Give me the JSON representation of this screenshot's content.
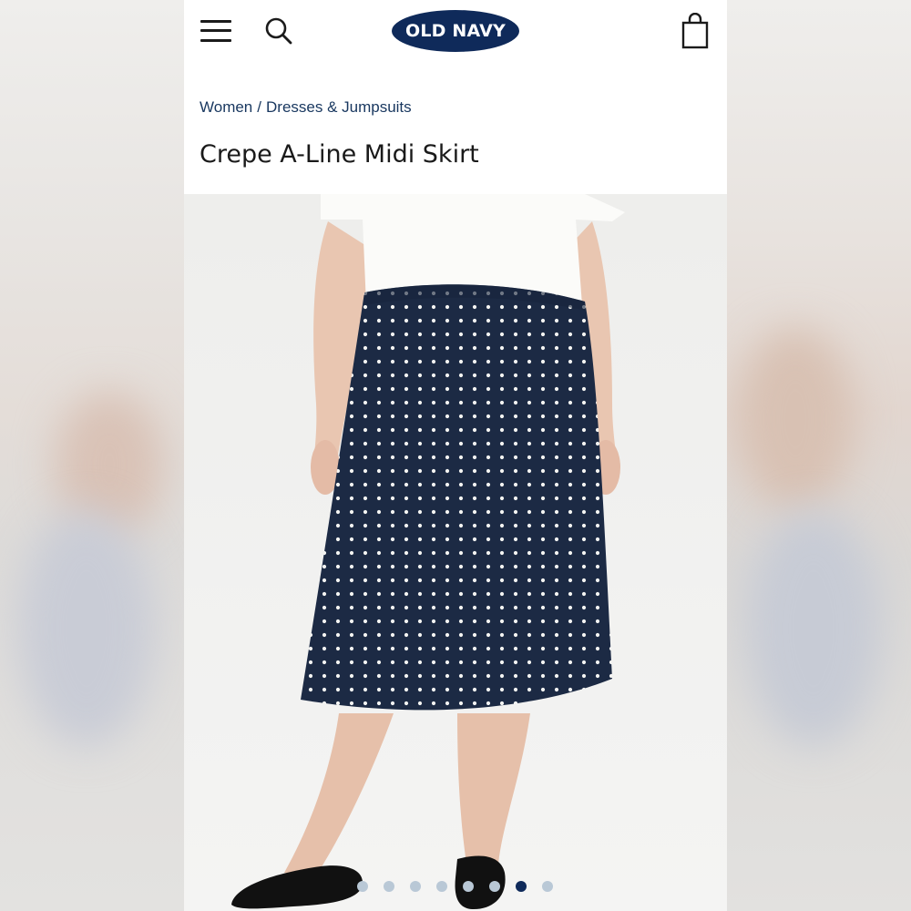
{
  "header": {
    "logo_text": "OLD NAVY",
    "menu_icon": "hamburger-menu-icon",
    "search_icon": "search-icon",
    "bag_icon": "shopping-bag-icon",
    "brand_color": "#0f2a5a"
  },
  "breadcrumb": {
    "items": [
      "Women",
      "Dresses & Jumpsuits"
    ],
    "separator": "/"
  },
  "product": {
    "title": "Crepe A-Line Midi Skirt",
    "image": "product-photo-navy-polka-dot-skirt"
  },
  "carousel": {
    "total": 8,
    "active_index": 6
  }
}
